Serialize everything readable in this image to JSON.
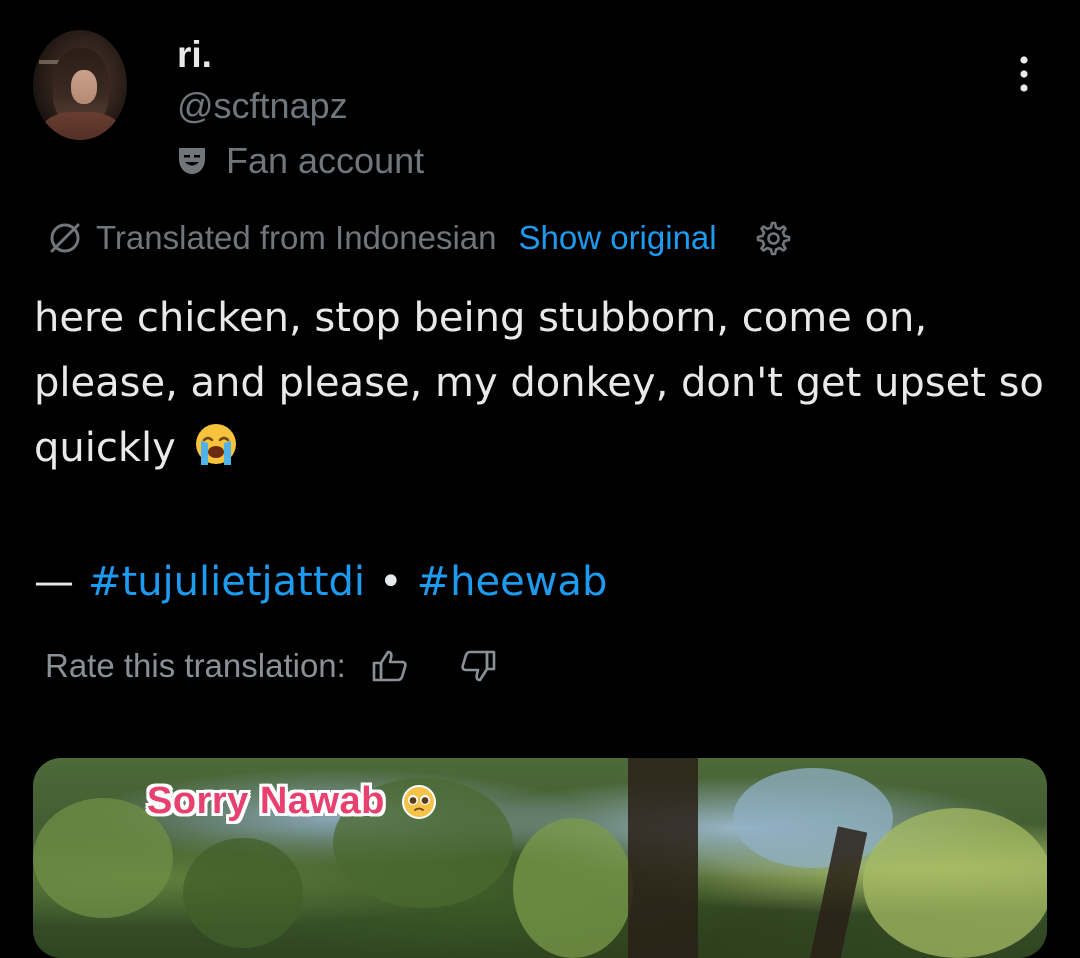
{
  "tweet": {
    "author": {
      "display_name": "ri.",
      "handle": "@scftnapz",
      "label": "Fan account",
      "avatar_icon": "avatar-photo"
    },
    "translation": {
      "note": "Translated from Indonesian",
      "show_original": "Show original"
    },
    "text": "here chicken, stop being stubborn, come on, please, and please, my donkey, don't get upset so quickly",
    "hashtags": {
      "dash": "—",
      "first": "#tujulietjattdi",
      "separator": "•",
      "second": "#heewab"
    },
    "rate": {
      "label": "Rate this translation:"
    },
    "media": {
      "caption": "Sorry Nawab"
    }
  },
  "colors": {
    "background": "#000000",
    "text_primary": "#e7e9ea",
    "text_secondary": "#71767b",
    "link": "#1d9bf0",
    "caption_pink": "#e8406f"
  },
  "icons": {
    "more": "more-vertical-icon",
    "label": "theater-mask-icon",
    "translate": "globe-icon",
    "settings": "gear-icon",
    "emoji_text": "loudly-crying-face-emoji",
    "thumb_up": "thumbs-up-icon",
    "thumb_down": "thumbs-down-icon",
    "emoji_caption": "pleading-face-emoji"
  }
}
